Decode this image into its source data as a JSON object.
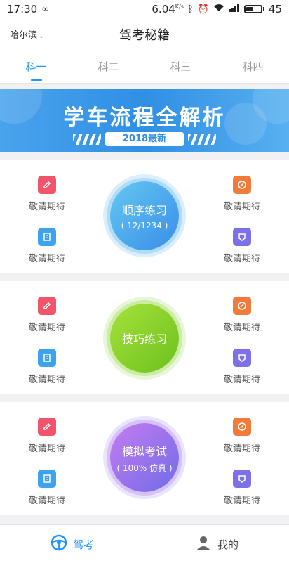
{
  "status_bar": {
    "time": "17:30",
    "speed": "6.04",
    "speed_unit": "K/s",
    "battery": "45",
    "battery_level": 0.45
  },
  "header": {
    "city": "哈尔滨",
    "title": "驾考秘籍"
  },
  "tabs": [
    {
      "label": "科一",
      "active": true
    },
    {
      "label": "科二",
      "active": false
    },
    {
      "label": "科三",
      "active": false
    },
    {
      "label": "科四",
      "active": false
    }
  ],
  "banner": {
    "title": "学车流程全解析",
    "badge": "2018最新"
  },
  "sections": [
    {
      "main_label": "顺序练习",
      "main_sub": "( 12/1234 )",
      "features": [
        "敬请期待",
        "敬请期待",
        "敬请期待",
        "敬请期待"
      ]
    },
    {
      "main_label": "技巧练习",
      "main_sub": "",
      "features": [
        "敬请期待",
        "敬请期待",
        "敬请期待",
        "敬请期待"
      ]
    },
    {
      "main_label": "模拟考试",
      "main_sub": "( 100% 仿真 )",
      "features": [
        "敬请期待",
        "敬请期待",
        "敬请期待",
        "敬请期待"
      ]
    }
  ],
  "bottom_nav": [
    {
      "label": "驾考",
      "icon": "steering-wheel-icon",
      "active": true
    },
    {
      "label": "我的",
      "icon": "user-icon",
      "active": false
    }
  ],
  "colors": {
    "accent": "#2196f3",
    "banner": "#2f8fe4",
    "feature_red": "#f2556b",
    "feature_orange": "#f27a3a",
    "feature_blue": "#3da3ee",
    "feature_purple": "#7e70e8",
    "circle_blue": "#3da3ee",
    "circle_green": "#7ccc2a",
    "circle_purple": "#8b6cf0"
  }
}
